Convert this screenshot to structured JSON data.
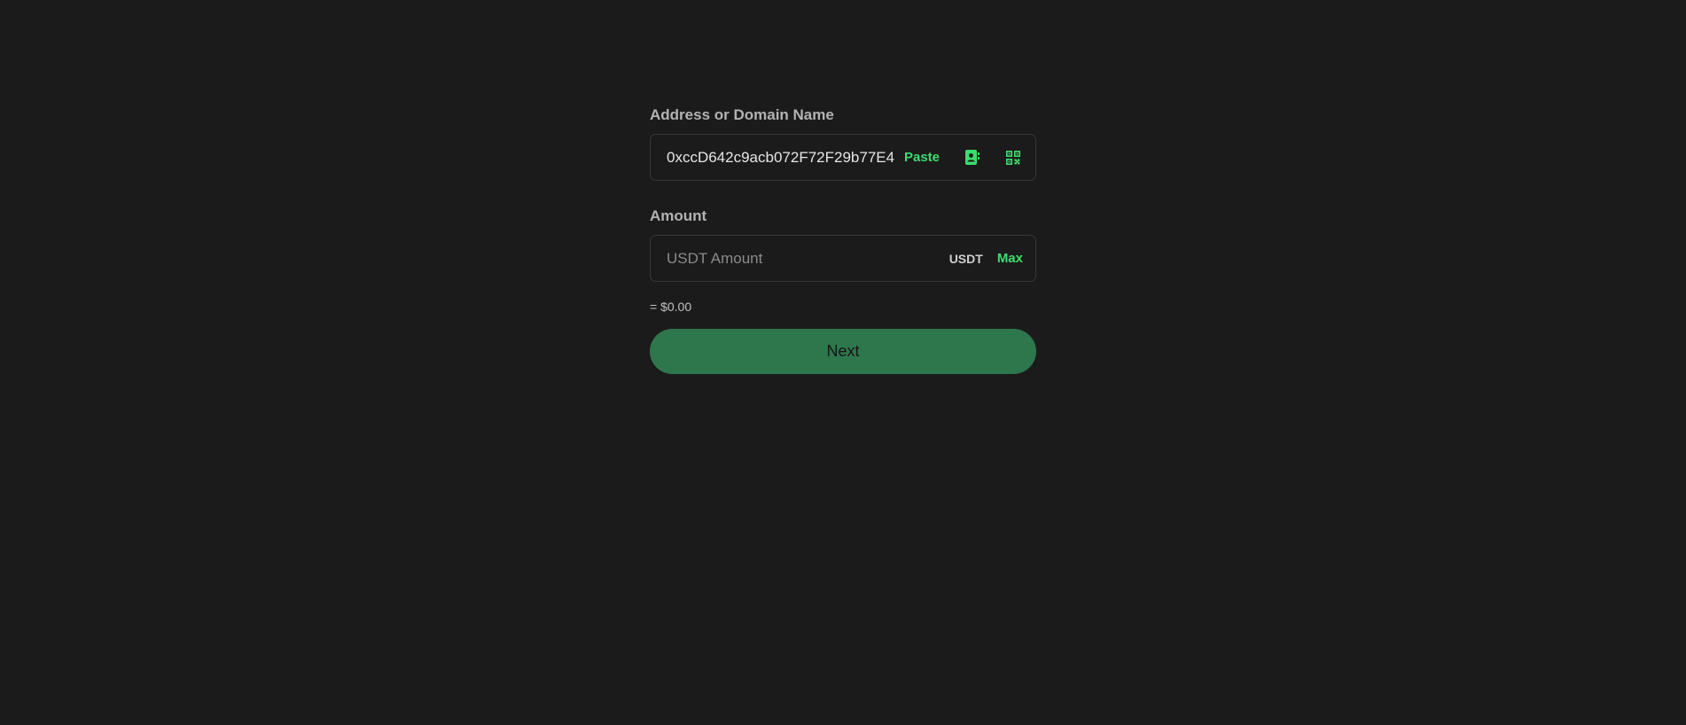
{
  "address": {
    "label": "Address or Domain Name",
    "value": "0xccD642c9acb072F72F29b77E4",
    "paste_label": "Paste",
    "contacts_icon": "address-book-icon",
    "qr_icon": "qr-scan-icon"
  },
  "amount": {
    "label": "Amount",
    "placeholder": "USDT Amount",
    "value": "",
    "token": "USDT",
    "max_label": "Max",
    "fiat_value": "= $0.00"
  },
  "actions": {
    "next_label": "Next"
  },
  "colors": {
    "background": "#1b1b1b",
    "accent": "#3ddc6e",
    "primary_button": "#2e774d"
  }
}
